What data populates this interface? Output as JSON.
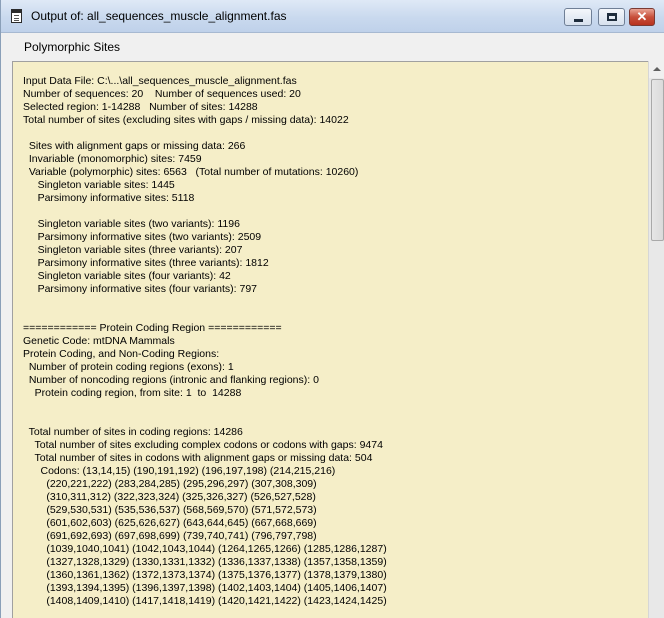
{
  "window": {
    "title": "Output of: all_sequences_muscle_alignment.fas",
    "icon": "document-icon",
    "buttons": {
      "minimize": "minimize",
      "maximize": "maximize",
      "close": "close"
    }
  },
  "menu": {
    "items": [
      "Polymorphic Sites"
    ]
  },
  "output": {
    "lines": [
      "Input Data File: C:\\...\\all_sequences_muscle_alignment.fas",
      "Number of sequences: 20    Number of sequences used: 20",
      "Selected region: 1-14288   Number of sites: 14288",
      "Total number of sites (excluding sites with gaps / missing data): 14022",
      "",
      "  Sites with alignment gaps or missing data: 266",
      "  Invariable (monomorphic) sites: 7459",
      "  Variable (polymorphic) sites: 6563   (Total number of mutations: 10260)",
      "     Singleton variable sites: 1445",
      "     Parsimony informative sites: 5118",
      "",
      "     Singleton variable sites (two variants): 1196",
      "     Parsimony informative sites (two variants): 2509",
      "     Singleton variable sites (three variants): 207",
      "     Parsimony informative sites (three variants): 1812",
      "     Singleton variable sites (four variants): 42",
      "     Parsimony informative sites (four variants): 797",
      "",
      "",
      "============ Protein Coding Region ============",
      "Genetic Code: mtDNA Mammals",
      "Protein Coding, and Non-Coding Regions:",
      "  Number of protein coding regions (exons): 1",
      "  Number of noncoding regions (intronic and flanking regions): 0",
      "    Protein coding region, from site: 1  to  14288",
      "",
      "",
      "  Total number of sites in coding regions: 14286",
      "    Total number of sites excluding complex codons or codons with gaps: 9474",
      "    Total number of sites in codons with alignment gaps or missing data: 504",
      "      Codons: (13,14,15) (190,191,192) (196,197,198) (214,215,216)",
      "        (220,221,222) (283,284,285) (295,296,297) (307,308,309)",
      "        (310,311,312) (322,323,324) (325,326,327) (526,527,528)",
      "        (529,530,531) (535,536,537) (568,569,570) (571,572,573)",
      "        (601,602,603) (625,626,627) (643,644,645) (667,668,669)",
      "        (691,692,693) (697,698,699) (739,740,741) (796,797,798)",
      "        (1039,1040,1041) (1042,1043,1044) (1264,1265,1266) (1285,1286,1287)",
      "        (1327,1328,1329) (1330,1331,1332) (1336,1337,1338) (1357,1358,1359)",
      "        (1360,1361,1362) (1372,1373,1374) (1375,1376,1377) (1378,1379,1380)",
      "        (1393,1394,1395) (1396,1397,1398) (1402,1403,1404) (1405,1406,1407)",
      "        (1408,1409,1410) (1417,1418,1419) (1420,1421,1422) (1423,1424,1425)"
    ]
  },
  "scrollbar": {
    "icon": "scroll-up-arrow-icon"
  }
}
